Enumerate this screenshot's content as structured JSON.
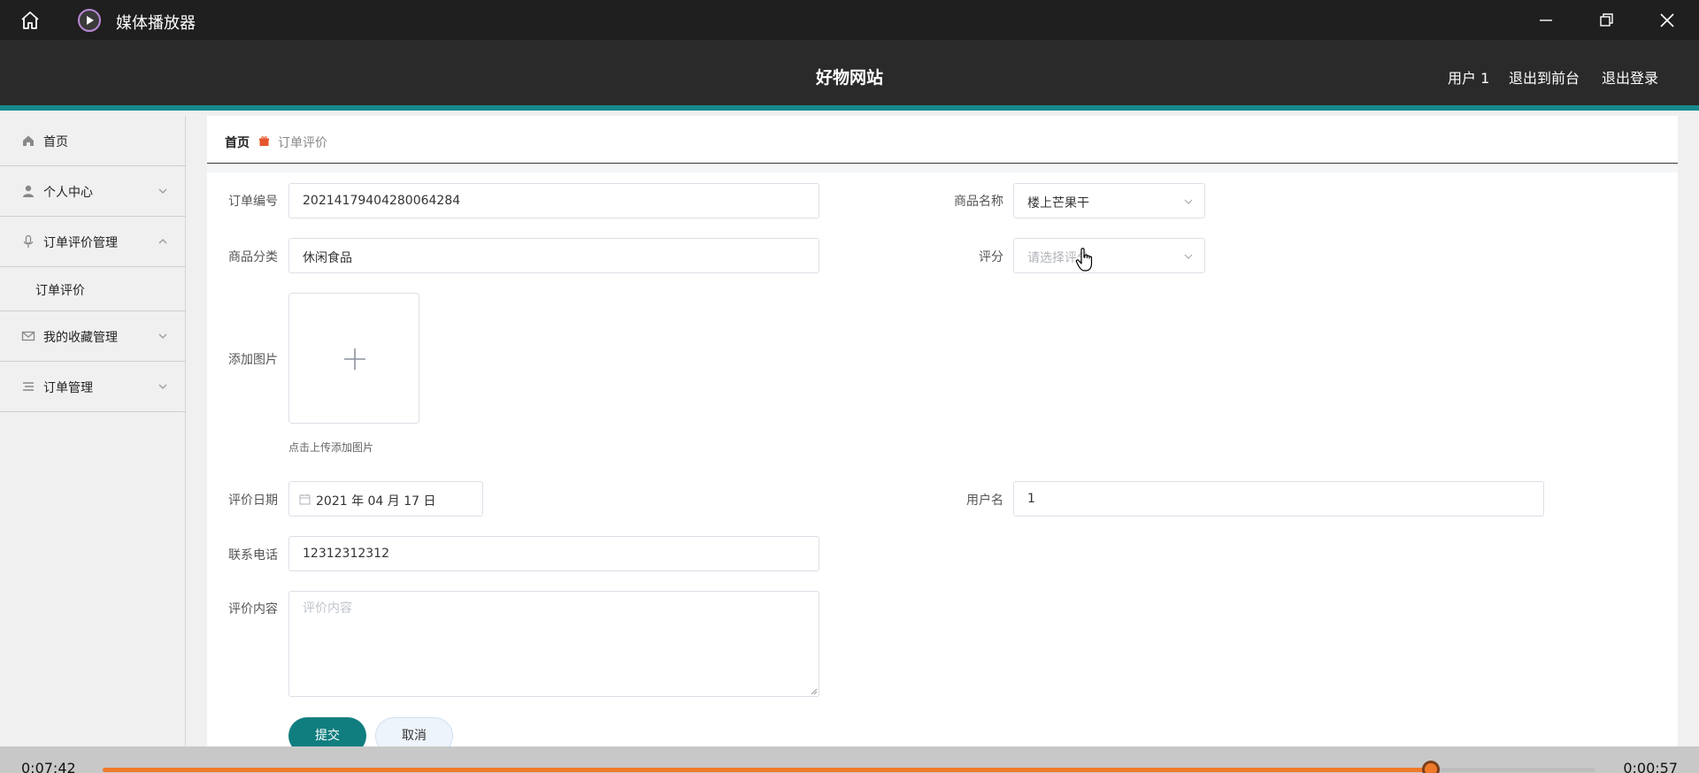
{
  "titlebar": {
    "app_title": "媒体播放器"
  },
  "header": {
    "site_title": "好物网站",
    "user_label": "用户 1",
    "front_link": "退出到前台",
    "logout_link": "退出登录"
  },
  "sidebar": {
    "items": [
      {
        "label": "首页"
      },
      {
        "label": "个人中心"
      },
      {
        "label": "订单评价管理"
      },
      {
        "label": "订单评价"
      },
      {
        "label": "我的收藏管理"
      },
      {
        "label": "订单管理"
      }
    ]
  },
  "breadcrumb": {
    "home": "首页",
    "current": "订单评价"
  },
  "form": {
    "order_no_label": "订单编号",
    "order_no_value": "20214179404280064284",
    "product_name_label": "商品名称",
    "product_name_value": "楼上芒果干",
    "category_label": "商品分类",
    "category_value": "休闲食品",
    "score_label": "评分",
    "score_placeholder": "请选择评分",
    "image_label": "添加图片",
    "upload_tip": "点击上传添加图片",
    "date_label": "评价日期",
    "date_value": "2021 年 04 月 17 日",
    "username_label": "用户名",
    "username_value": "1",
    "phone_label": "联系电话",
    "phone_value": "12312312312",
    "content_label": "评价内容",
    "content_placeholder": "评价内容",
    "submit_label": "提交",
    "cancel_label": "取消"
  },
  "player": {
    "elapsed": "0:07:42",
    "remaining": "0:00:57",
    "progress": 0.89
  },
  "colors": {
    "accent": "#17898b",
    "button": "#107e7f",
    "progress": "#f07a2a"
  }
}
